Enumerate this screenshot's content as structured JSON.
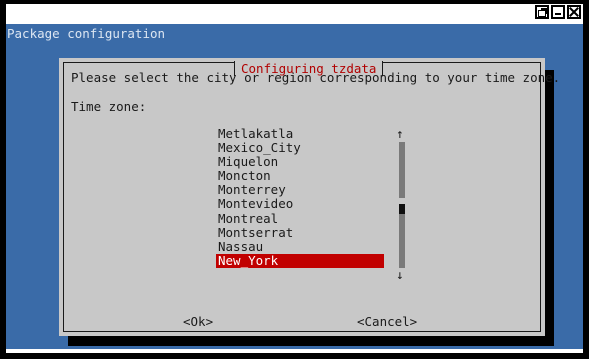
{
  "window": {
    "controls": [
      "restore-icon",
      "minimize-icon",
      "close-icon"
    ]
  },
  "terminal": {
    "header": "Package configuration"
  },
  "dialog": {
    "title": "Configuring tzdata",
    "prompt": "Please select the city or region corresponding to your time zone.",
    "field_label": "Time zone:",
    "items": [
      "Metlakatla",
      "Mexico_City",
      "Miquelon",
      "Moncton",
      "Monterrey",
      "Montevideo",
      "Montreal",
      "Montserrat",
      "Nassau",
      "New_York"
    ],
    "selected_item": "New_York",
    "scroll_up": "↑",
    "scroll_down": "↓",
    "ok_label": "<Ok>",
    "cancel_label": "<Cancel>"
  },
  "colors": {
    "terminal_bg": "#3a6ba8",
    "dialog_bg": "#c8c8c8",
    "title_text": "#b10000",
    "selection_bg": "#c10000"
  }
}
